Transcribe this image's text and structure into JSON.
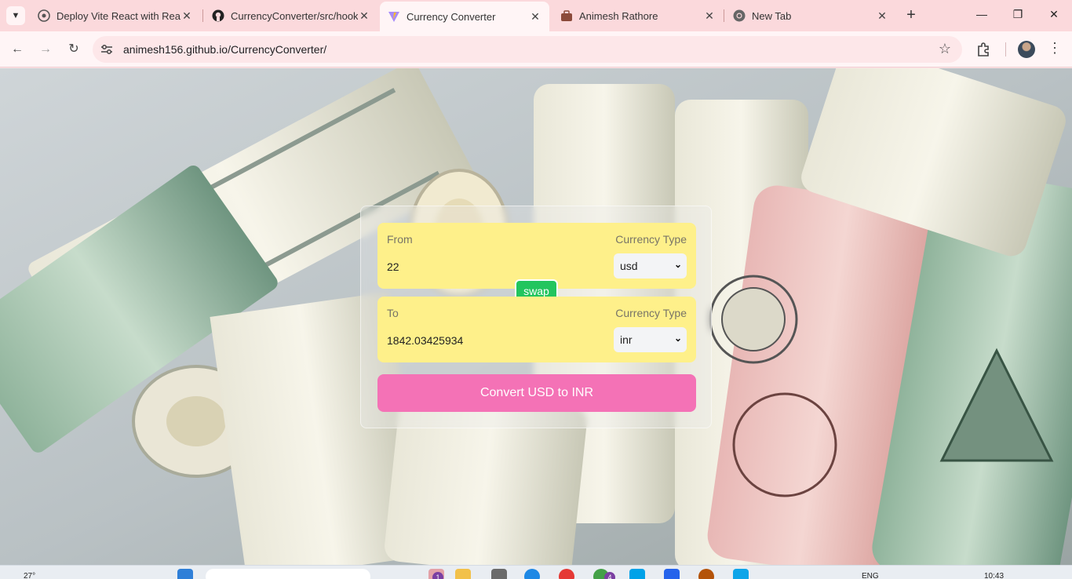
{
  "browser": {
    "tabs": [
      {
        "title": "Deploy Vite React with React",
        "icon": "bubble-icon"
      },
      {
        "title": "CurrencyConverter/src/hook",
        "icon": "github-icon"
      },
      {
        "title": "Currency Converter",
        "icon": "vite-icon",
        "active": true
      },
      {
        "title": "Animesh Rathore",
        "icon": "briefcase-icon"
      },
      {
        "title": "New Tab",
        "icon": "chrome-icon"
      }
    ],
    "new_tab_label": "+",
    "url": "animesh156.github.io/CurrencyConverter/"
  },
  "converter": {
    "from": {
      "label": "From",
      "currency_type_label": "Currency Type",
      "amount": "22",
      "currency": "usd"
    },
    "to": {
      "label": "To",
      "currency_type_label": "Currency Type",
      "amount": "1842.03425934",
      "currency": "inr"
    },
    "swap_label": "swap",
    "convert_label": "Convert USD to INR"
  },
  "taskbar": {
    "weather": "27°",
    "language": "ENG",
    "time": "10:43",
    "badge_1": "1",
    "badge_2": "4"
  },
  "colors": {
    "from_to_box": "#fef08a",
    "swap_button": "#22c55e",
    "convert_button": "#f472b6"
  }
}
